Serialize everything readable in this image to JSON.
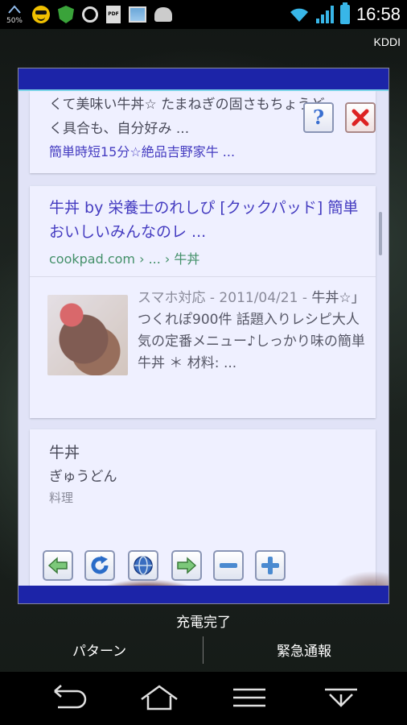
{
  "status_bar": {
    "battery_percent": "50%",
    "pdf_label": "PDF",
    "time": "16:58",
    "carrier": "KDDI",
    "icons": [
      "battery-saver-icon",
      "smiley-icon",
      "shield-icon",
      "alarm-icon",
      "pdf-icon",
      "photo-icon",
      "android-icon",
      "wifi-icon",
      "signal-icon",
      "battery-icon"
    ]
  },
  "popup": {
    "card1": {
      "line1": "くて美味い牛丼☆ たまねぎの固さもちょうど",
      "line2": "く具合も、自分好み ...",
      "link": "簡単時短15分☆絶品吉野家牛 ..."
    },
    "card2": {
      "title": "牛丼 by 栄養士のれしぴ [クックパッド] 簡単おいしいみんなのレ ...",
      "url": "cookpad.com › ... › 牛丼",
      "meta": "スマホ対応 - 2011/04/21 - ",
      "description": "牛丼☆」つくれぽ900件 話題入りレシピ大人気の定番メニュー♪しっかり味の簡単牛丼 ＊ 材料: ..."
    },
    "card3": {
      "title": "牛丼",
      "reading": "ぎゅうどん",
      "type": "料理"
    },
    "help_label": "?",
    "toolbar": [
      "back-icon",
      "refresh-icon",
      "globe-icon",
      "forward-icon",
      "zoom-out-icon",
      "zoom-in-icon"
    ]
  },
  "lockscreen": {
    "charge_status": "充電完了",
    "pattern_label": "パターン",
    "emergency_label": "緊急通報"
  },
  "nav": [
    "back-icon",
    "home-icon",
    "menu-icon",
    "hide-icon"
  ],
  "colors": {
    "link": "#1a0dab",
    "url": "#1a7f37",
    "popup_bar": "#1c24a8",
    "status_accent": "#38b6e8"
  }
}
